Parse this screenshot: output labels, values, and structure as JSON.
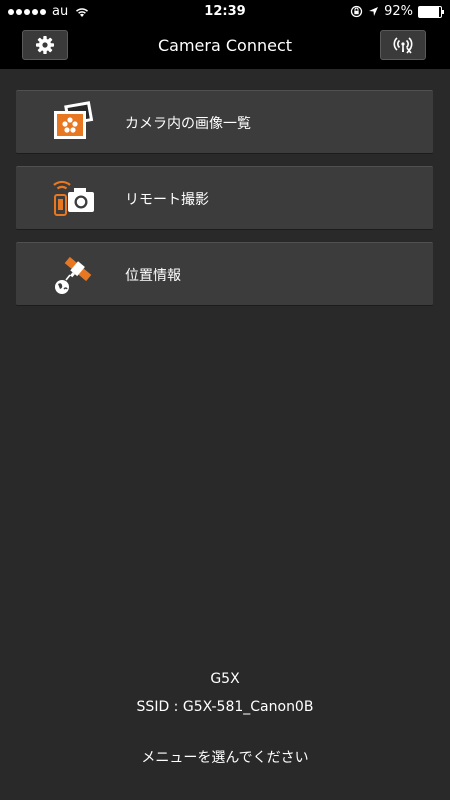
{
  "status_bar": {
    "carrier": "au",
    "time": "12:39",
    "battery_percent": "92%",
    "battery_level": 0.92,
    "icons": [
      "signal-dots",
      "wifi-icon",
      "rotation-lock-icon",
      "location-arrow-icon",
      "battery-icon"
    ]
  },
  "nav": {
    "title": "Camera Connect",
    "left_button_icon": "gear-icon",
    "right_button_icon": "wireless-disconnect-icon"
  },
  "menu": {
    "items": [
      {
        "label": "カメラ内の画像一覧",
        "icon": "image-gallery-icon"
      },
      {
        "label": "リモート撮影",
        "icon": "remote-shooting-icon"
      },
      {
        "label": "位置情報",
        "icon": "location-satellite-icon"
      }
    ]
  },
  "footer": {
    "camera_model": "G5X",
    "ssid": "SSID : G5X-581_Canon0B",
    "instruction": "メニューを選んでください"
  },
  "colors": {
    "accent": "#e87722",
    "background": "#292929",
    "bar": "#000000",
    "item": "#3c3c3c"
  }
}
